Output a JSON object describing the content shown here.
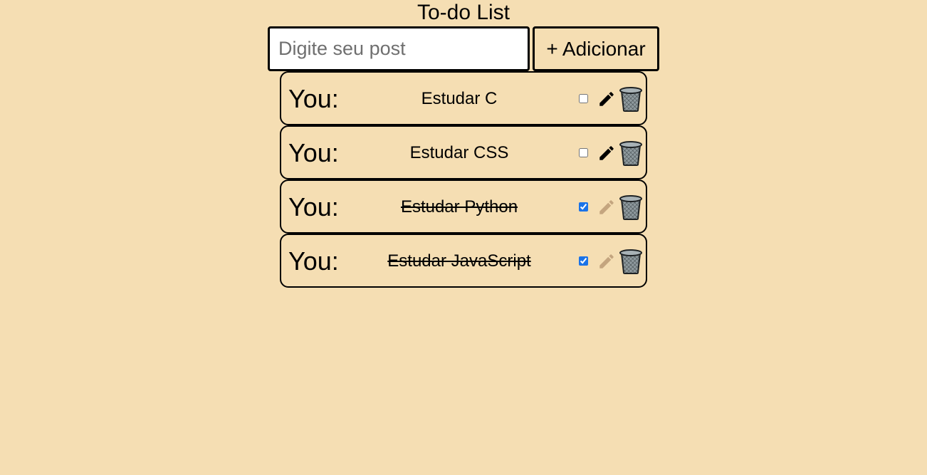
{
  "header": {
    "title": "To-do List"
  },
  "form": {
    "placeholder": "Digite seu post",
    "add_label": "+ Adicionar"
  },
  "colors": {
    "background": "#f5deb3",
    "pencil_active": "#000000",
    "pencil_disabled": "#c4a57f",
    "checkbox_accent": "#1a73e8"
  },
  "todos": [
    {
      "author": "You:",
      "text": "Estudar C",
      "done": false
    },
    {
      "author": "You:",
      "text": "Estudar CSS",
      "done": false
    },
    {
      "author": "You:",
      "text": "Estudar Python",
      "done": true
    },
    {
      "author": "You:",
      "text": "Estudar JavaScript",
      "done": true
    }
  ]
}
